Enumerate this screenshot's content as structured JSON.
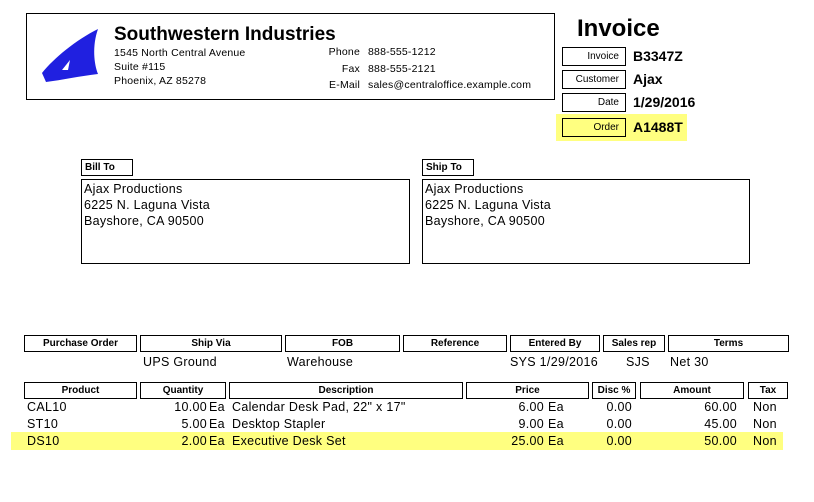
{
  "company": {
    "name": "Southwestern Industries",
    "address1": "1545 North Central Avenue",
    "address2": "Suite #115",
    "address3": "Phoenix, AZ 85278",
    "phone_label": "Phone",
    "phone": "888-555-1212",
    "fax_label": "Fax",
    "fax": "888-555-2121",
    "email_label": "E-Mail",
    "email": "sales@centraloffice.example.com"
  },
  "invoice": {
    "title": "Invoice",
    "invoice_label": "Invoice",
    "invoice_value": "B3347Z",
    "customer_label": "Customer",
    "customer_value": "Ajax",
    "date_label": "Date",
    "date_value": "1/29/2016",
    "order_label": "Order",
    "order_value": "A1488T",
    "highlight_color": "#ffff80"
  },
  "bill_to": {
    "label": "Bill To",
    "line1": "Ajax Productions",
    "line2": "6225 N. Laguna Vista",
    "line3": "Bayshore, CA 90500"
  },
  "ship_to": {
    "label": "Ship To",
    "line1": "Ajax Productions",
    "line2": "6225 N. Laguna Vista",
    "line3": "Bayshore, CA 90500"
  },
  "order_info": {
    "headers": [
      "Purchase Order",
      "Ship Via",
      "FOB",
      "Reference",
      "Entered By",
      "Sales rep",
      "Terms"
    ],
    "values": [
      "",
      "UPS Ground",
      "Warehouse",
      "",
      "SYS 1/29/2016",
      "SJS",
      "Net 30"
    ]
  },
  "items": {
    "headers": [
      "Product",
      "Quantity",
      "Description",
      "Price",
      "Disc %",
      "Amount",
      "Tax"
    ],
    "rows": [
      {
        "product": "CAL10",
        "qty": "10.00",
        "qty_unit": "Ea",
        "desc": "Calendar Desk Pad, 22\" x 17\"",
        "price": "6.00",
        "price_unit": "Ea",
        "disc": "0.00",
        "amount": "60.00",
        "tax": "Non",
        "highlight": false
      },
      {
        "product": "ST10",
        "qty": "5.00",
        "qty_unit": "Ea",
        "desc": "Desktop Stapler",
        "price": "9.00",
        "price_unit": "Ea",
        "disc": "0.00",
        "amount": "45.00",
        "tax": "Non",
        "highlight": false
      },
      {
        "product": "DS10",
        "qty": "2.00",
        "qty_unit": "Ea",
        "desc": "Executive Desk Set",
        "price": "25.00",
        "price_unit": "Ea",
        "disc": "0.00",
        "amount": "50.00",
        "tax": "Non",
        "highlight": true
      }
    ]
  },
  "icons": {
    "logo": "sail-logo-icon"
  },
  "colors": {
    "logo_blue": "#2020e0"
  }
}
